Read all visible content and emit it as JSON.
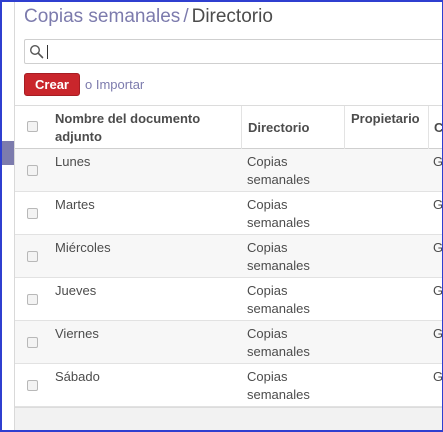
{
  "breadcrumb": {
    "parent": "Copias semanales",
    "separator": "/",
    "current": "Directorio"
  },
  "search": {
    "value": "",
    "placeholder": ""
  },
  "actions": {
    "create_label": "Crear",
    "or_text": "o",
    "import_label": "Importar"
  },
  "table": {
    "headers": {
      "name": "Nombre del documento adjunto",
      "directory": "Directorio",
      "owner": "Propietario",
      "cut_header": "C"
    },
    "rows": [
      {
        "name": "Lunes",
        "directory": "Copias semanales",
        "cut": "G S."
      },
      {
        "name": "Martes",
        "directory": "Copias semanales",
        "cut": "G S."
      },
      {
        "name": "Miércoles",
        "directory": "Copias semanales",
        "cut": "G S."
      },
      {
        "name": "Jueves",
        "directory": "Copias semanales",
        "cut": "G S."
      },
      {
        "name": "Viernes",
        "directory": "Copias semanales",
        "cut": "G S."
      },
      {
        "name": "Sábado",
        "directory": "Copias semanales",
        "cut": "G S."
      }
    ]
  },
  "colors": {
    "accent": "#7c7bad",
    "primary_button": "#c9262c",
    "frame": "#2f3fd0"
  },
  "icons": {
    "search": "search-icon",
    "checkbox": "checkbox-icon"
  }
}
